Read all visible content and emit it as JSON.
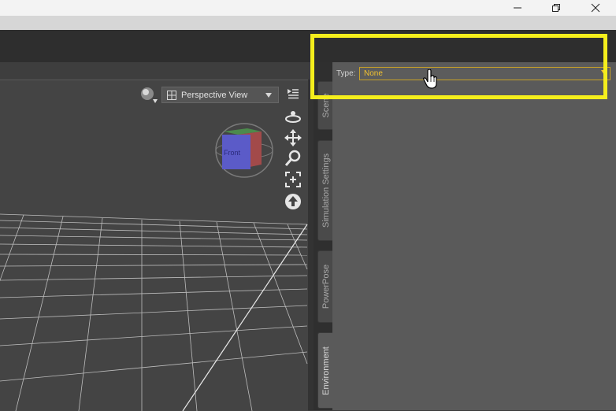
{
  "window_controls": [
    {
      "name": "minimize-button",
      "glyph": "—"
    },
    {
      "name": "restore-button",
      "glyph": "❐"
    },
    {
      "name": "close-button",
      "glyph": "✕"
    }
  ],
  "viewport": {
    "view_dropdown": {
      "label": "Perspective View"
    },
    "cube_face_label": "Front"
  },
  "side_tabs": [
    {
      "label": "Scene",
      "active": false
    },
    {
      "label": "Simulation Settings",
      "active": false
    },
    {
      "label": "PowerPose",
      "active": false
    },
    {
      "label": "Environment",
      "active": true
    }
  ],
  "panel": {
    "type_label": "Type:",
    "type_value": "None"
  },
  "colors": {
    "highlight": "#f5ee1c",
    "type_value_text": "#f2c230"
  }
}
